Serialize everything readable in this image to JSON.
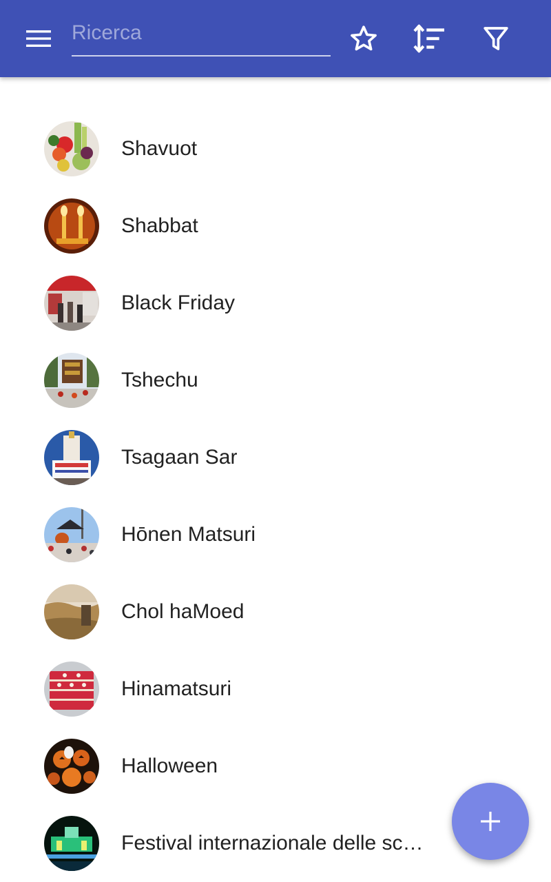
{
  "header": {
    "menu_icon": "menu-icon",
    "search": {
      "placeholder": "Ricerca",
      "value": ""
    },
    "actions": [
      {
        "name": "favorites",
        "icon": "star-outline-icon"
      },
      {
        "name": "sort",
        "icon": "sort-icon"
      },
      {
        "name": "filter",
        "icon": "filter-icon"
      }
    ],
    "color": "#3f51b5"
  },
  "list": {
    "items": [
      {
        "label": "Shavuot"
      },
      {
        "label": "Shabbat"
      },
      {
        "label": "Black Friday"
      },
      {
        "label": "Tshechu"
      },
      {
        "label": "Tsagaan Sar"
      },
      {
        "label": "Hōnen Matsuri"
      },
      {
        "label": "Chol haMoed"
      },
      {
        "label": "Hinamatsuri"
      },
      {
        "label": "Halloween"
      },
      {
        "label": "Festival internazionale delle sculture di ghiaccio e neve di Harbin"
      }
    ]
  },
  "fab": {
    "icon": "plus-icon",
    "color": "#7986e6"
  }
}
